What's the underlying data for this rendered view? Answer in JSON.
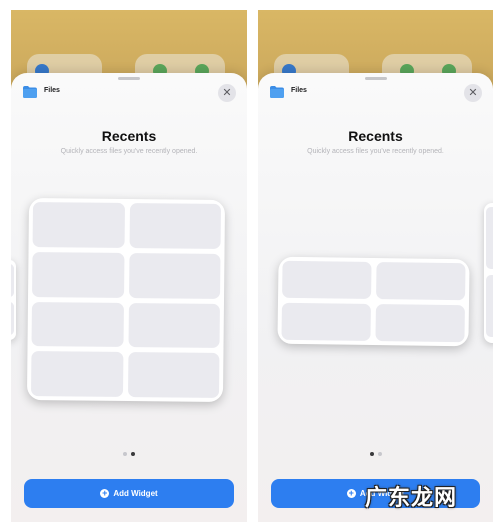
{
  "screens": [
    {
      "app_name": "Files",
      "title": "Recents",
      "subtitle": "Quickly access files you've recently opened.",
      "close_icon": "xmark-icon",
      "widget_size": "large",
      "page_index": 2,
      "page_count": 2,
      "add_button_label": "Add Widget"
    },
    {
      "app_name": "Files",
      "title": "Recents",
      "subtitle": "Quickly access files you've recently opened.",
      "close_icon": "xmark-icon",
      "widget_size": "medium",
      "page_index": 1,
      "page_count": 2,
      "add_button_label": "Add Widget"
    }
  ],
  "icons": {
    "app": "folder-icon",
    "close": "xmark-icon",
    "add": "plus-circle-icon"
  },
  "colors": {
    "accent": "#2d7ef0",
    "folder": "#3b8de6",
    "wallpaper": "#c7a45a"
  },
  "watermark": "广东龙网"
}
